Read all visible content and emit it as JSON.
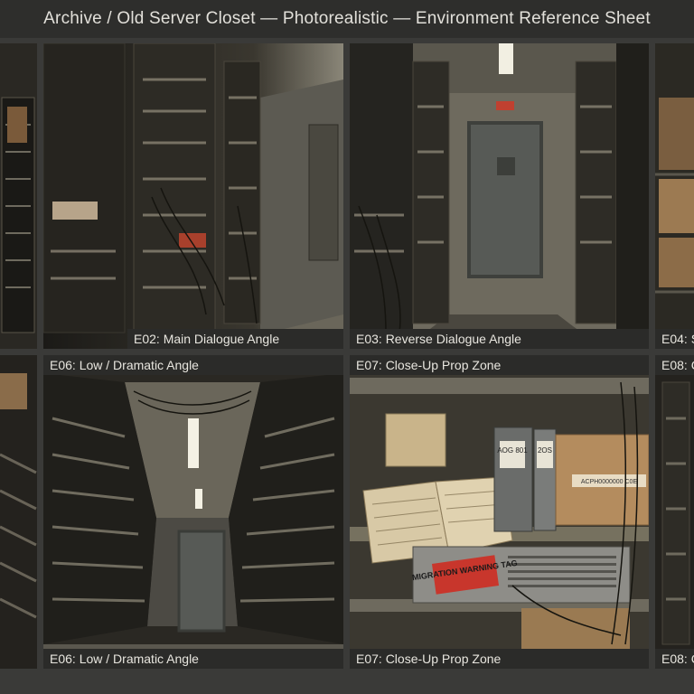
{
  "sheet": {
    "title": "Archive / Old Server Closet — Photorealistic — Environment Reference Sheet"
  },
  "panels": {
    "p01": {
      "caption": ""
    },
    "p02": {
      "caption": "E02: Main Dialogue Angle"
    },
    "p03": {
      "caption": "E03: Reverse Dialogue Angle"
    },
    "p04": {
      "caption": "E04: S"
    },
    "p05": {
      "caption": ""
    },
    "p06": {
      "caption_top": "E06: Low / Dramatic Angle",
      "caption_bottom": "E06: Low / Dramatic Angle"
    },
    "p07": {
      "caption_top": "E07: Close-Up Prop Zone",
      "caption_bottom": "E07: Close-Up Prop Zone"
    },
    "p08": {
      "caption_top": "E08: C",
      "caption_bottom": "E08: C"
    }
  },
  "props": {
    "warning_tag": "MIGRATION WARNING TAG",
    "binder_1": "AOG 801",
    "binder_2": "2OS",
    "box_label": "ACPH0000000 C0E"
  },
  "colors": {
    "header_bg": "#2e2e2c",
    "caption_bg": "#2b2b29",
    "warning_tag": "#c8362c"
  }
}
